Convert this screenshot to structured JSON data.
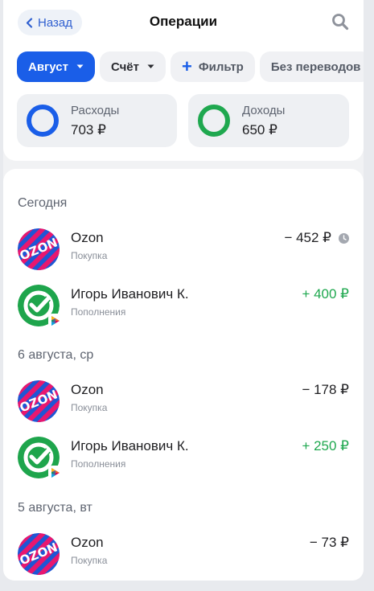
{
  "header": {
    "back_label": "Назад",
    "title": "Операции"
  },
  "chips": [
    {
      "label": "Август",
      "active": true
    },
    {
      "label": "Счёт"
    },
    {
      "label": "Фильтр"
    },
    {
      "label": "Без переводов"
    }
  ],
  "summary": {
    "expenses": {
      "label": "Расходы",
      "value": "703 ₽"
    },
    "income": {
      "label": "Доходы",
      "value": "650 ₽"
    }
  },
  "groups": [
    {
      "date": "Сегодня"
    },
    {
      "date": "6 августа, ср"
    },
    {
      "date": "5 августа, вт"
    }
  ],
  "operations": [
    {
      "name": "Ozon",
      "category": "Покупка",
      "amount": "− 452 ₽",
      "icon": "ozon-logo",
      "pending": true
    },
    {
      "name": "Игорь Иванович К.",
      "category": "Пополнения",
      "amount": "+ 400 ₽",
      "icon": "sber-logo"
    },
    {
      "name": "Ozon",
      "category": "Покупка",
      "amount": "− 178 ₽",
      "icon": "ozon-logo"
    },
    {
      "name": "Игорь Иванович К.",
      "category": "Пополнения",
      "amount": "+ 250 ₽",
      "icon": "sber-logo"
    },
    {
      "name": "Ozon",
      "category": "Покупка",
      "amount": "− 73 ₽",
      "icon": "ozon-logo"
    }
  ],
  "colors": {
    "accent": "#1a5ee8",
    "positive": "#1fa84f",
    "ozon": "#1f56d4",
    "ozon_stripes": "#e8176f"
  }
}
